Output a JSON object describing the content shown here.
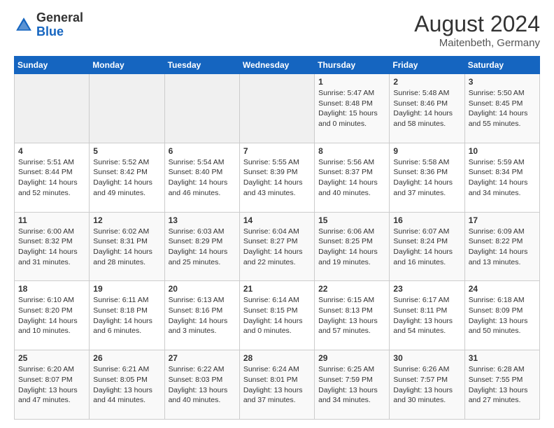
{
  "header": {
    "logo_general": "General",
    "logo_blue": "Blue",
    "month_year": "August 2024",
    "location": "Maitenbeth, Germany"
  },
  "weekdays": [
    "Sunday",
    "Monday",
    "Tuesday",
    "Wednesday",
    "Thursday",
    "Friday",
    "Saturday"
  ],
  "weeks": [
    [
      {
        "day": "",
        "info": ""
      },
      {
        "day": "",
        "info": ""
      },
      {
        "day": "",
        "info": ""
      },
      {
        "day": "",
        "info": ""
      },
      {
        "day": "1",
        "info": "Sunrise: 5:47 AM\nSunset: 8:48 PM\nDaylight: 15 hours and 0 minutes."
      },
      {
        "day": "2",
        "info": "Sunrise: 5:48 AM\nSunset: 8:46 PM\nDaylight: 14 hours and 58 minutes."
      },
      {
        "day": "3",
        "info": "Sunrise: 5:50 AM\nSunset: 8:45 PM\nDaylight: 14 hours and 55 minutes."
      }
    ],
    [
      {
        "day": "4",
        "info": "Sunrise: 5:51 AM\nSunset: 8:44 PM\nDaylight: 14 hours and 52 minutes."
      },
      {
        "day": "5",
        "info": "Sunrise: 5:52 AM\nSunset: 8:42 PM\nDaylight: 14 hours and 49 minutes."
      },
      {
        "day": "6",
        "info": "Sunrise: 5:54 AM\nSunset: 8:40 PM\nDaylight: 14 hours and 46 minutes."
      },
      {
        "day": "7",
        "info": "Sunrise: 5:55 AM\nSunset: 8:39 PM\nDaylight: 14 hours and 43 minutes."
      },
      {
        "day": "8",
        "info": "Sunrise: 5:56 AM\nSunset: 8:37 PM\nDaylight: 14 hours and 40 minutes."
      },
      {
        "day": "9",
        "info": "Sunrise: 5:58 AM\nSunset: 8:36 PM\nDaylight: 14 hours and 37 minutes."
      },
      {
        "day": "10",
        "info": "Sunrise: 5:59 AM\nSunset: 8:34 PM\nDaylight: 14 hours and 34 minutes."
      }
    ],
    [
      {
        "day": "11",
        "info": "Sunrise: 6:00 AM\nSunset: 8:32 PM\nDaylight: 14 hours and 31 minutes."
      },
      {
        "day": "12",
        "info": "Sunrise: 6:02 AM\nSunset: 8:31 PM\nDaylight: 14 hours and 28 minutes."
      },
      {
        "day": "13",
        "info": "Sunrise: 6:03 AM\nSunset: 8:29 PM\nDaylight: 14 hours and 25 minutes."
      },
      {
        "day": "14",
        "info": "Sunrise: 6:04 AM\nSunset: 8:27 PM\nDaylight: 14 hours and 22 minutes."
      },
      {
        "day": "15",
        "info": "Sunrise: 6:06 AM\nSunset: 8:25 PM\nDaylight: 14 hours and 19 minutes."
      },
      {
        "day": "16",
        "info": "Sunrise: 6:07 AM\nSunset: 8:24 PM\nDaylight: 14 hours and 16 minutes."
      },
      {
        "day": "17",
        "info": "Sunrise: 6:09 AM\nSunset: 8:22 PM\nDaylight: 14 hours and 13 minutes."
      }
    ],
    [
      {
        "day": "18",
        "info": "Sunrise: 6:10 AM\nSunset: 8:20 PM\nDaylight: 14 hours and 10 minutes."
      },
      {
        "day": "19",
        "info": "Sunrise: 6:11 AM\nSunset: 8:18 PM\nDaylight: 14 hours and 6 minutes."
      },
      {
        "day": "20",
        "info": "Sunrise: 6:13 AM\nSunset: 8:16 PM\nDaylight: 14 hours and 3 minutes."
      },
      {
        "day": "21",
        "info": "Sunrise: 6:14 AM\nSunset: 8:15 PM\nDaylight: 14 hours and 0 minutes."
      },
      {
        "day": "22",
        "info": "Sunrise: 6:15 AM\nSunset: 8:13 PM\nDaylight: 13 hours and 57 minutes."
      },
      {
        "day": "23",
        "info": "Sunrise: 6:17 AM\nSunset: 8:11 PM\nDaylight: 13 hours and 54 minutes."
      },
      {
        "day": "24",
        "info": "Sunrise: 6:18 AM\nSunset: 8:09 PM\nDaylight: 13 hours and 50 minutes."
      }
    ],
    [
      {
        "day": "25",
        "info": "Sunrise: 6:20 AM\nSunset: 8:07 PM\nDaylight: 13 hours and 47 minutes."
      },
      {
        "day": "26",
        "info": "Sunrise: 6:21 AM\nSunset: 8:05 PM\nDaylight: 13 hours and 44 minutes."
      },
      {
        "day": "27",
        "info": "Sunrise: 6:22 AM\nSunset: 8:03 PM\nDaylight: 13 hours and 40 minutes."
      },
      {
        "day": "28",
        "info": "Sunrise: 6:24 AM\nSunset: 8:01 PM\nDaylight: 13 hours and 37 minutes."
      },
      {
        "day": "29",
        "info": "Sunrise: 6:25 AM\nSunset: 7:59 PM\nDaylight: 13 hours and 34 minutes."
      },
      {
        "day": "30",
        "info": "Sunrise: 6:26 AM\nSunset: 7:57 PM\nDaylight: 13 hours and 30 minutes."
      },
      {
        "day": "31",
        "info": "Sunrise: 6:28 AM\nSunset: 7:55 PM\nDaylight: 13 hours and 27 minutes."
      }
    ]
  ]
}
